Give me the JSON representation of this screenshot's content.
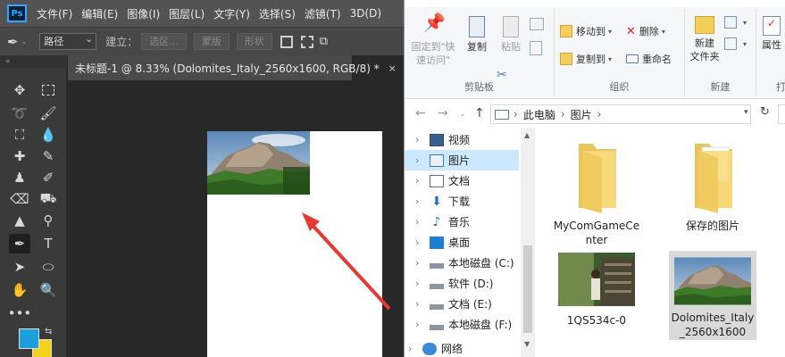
{
  "photoshop": {
    "logo": "Ps",
    "menu": [
      "文件(F)",
      "编辑(E)",
      "图像(I)",
      "图层(L)",
      "文字(Y)",
      "选择(S)",
      "滤镜(T)",
      "3D(D)"
    ],
    "options": {
      "mode": "路径",
      "make_label": "建立：",
      "selection": "选区...",
      "mask": "蒙版",
      "shape": "形状"
    },
    "collapse_mark": "«",
    "doc_tab": "未标题-1 @ 8.33% (Dolomites_Italy_2560x1600, RGB/8) *",
    "doc_close": "×",
    "fg_color": "#1ba0dd",
    "bg_color": "#f2d31b"
  },
  "explorer": {
    "ribbon": {
      "clipboard": {
        "title": "剪贴板",
        "pin": "固定到\"快速访问\"",
        "copy": "复制",
        "paste": "粘贴"
      },
      "organize": {
        "title": "组织",
        "move_to": "移动到",
        "copy_to": "复制到",
        "delete": "删除",
        "rename": "重命名"
      },
      "new": {
        "title": "新建",
        "new_folder": "新建\n文件夹"
      },
      "open": {
        "properties": "属性",
        "title_partial": "打"
      }
    },
    "address": {
      "path": [
        "此电脑",
        "图片"
      ],
      "sep": "›"
    },
    "nav": [
      {
        "label": "视频",
        "icon": "video-icon"
      },
      {
        "label": "图片",
        "icon": "pictures-icon",
        "selected": true
      },
      {
        "label": "文档",
        "icon": "documents-icon"
      },
      {
        "label": "下载",
        "icon": "download-icon"
      },
      {
        "label": "音乐",
        "icon": "music-icon"
      },
      {
        "label": "桌面",
        "icon": "desktop-icon"
      },
      {
        "label": "本地磁盘 (C:)",
        "icon": "drive-icon"
      },
      {
        "label": "软件 (D:)",
        "icon": "drive-icon"
      },
      {
        "label": "文档 (E:)",
        "icon": "drive-icon"
      },
      {
        "label": "本地磁盘 (F:)",
        "icon": "drive-icon"
      },
      {
        "label": "网络",
        "icon": "network-icon"
      }
    ],
    "files": [
      {
        "label": "MyComGameCenter",
        "kind": "folder"
      },
      {
        "label": "保存的图片",
        "kind": "folder"
      },
      {
        "label": "1QS534c-0",
        "kind": "photo"
      },
      {
        "label": "Dolomites_Italy_2560x1600",
        "kind": "photo",
        "selected": true
      }
    ]
  },
  "accent_colors": {
    "annotation_arrow": "#e53935",
    "selection": "#cce8ff",
    "ps_panel": "#535353"
  }
}
